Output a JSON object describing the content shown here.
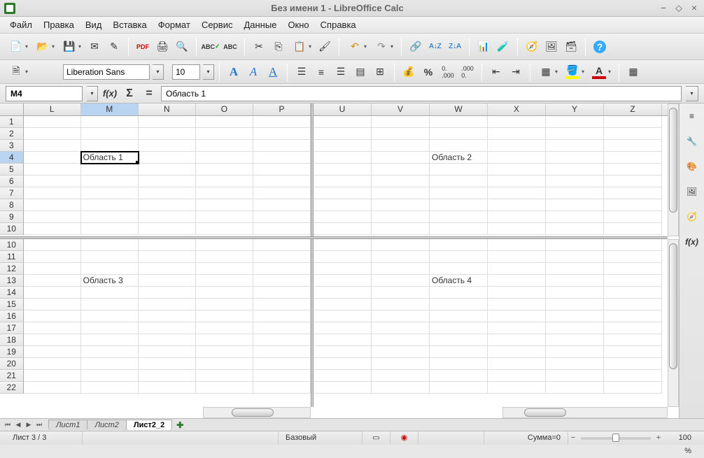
{
  "window": {
    "title": "Без имени 1 - LibreOffice Calc"
  },
  "menu": [
    "Файл",
    "Правка",
    "Вид",
    "Вставка",
    "Формат",
    "Сервис",
    "Данные",
    "Окно",
    "Справка"
  ],
  "font": {
    "name": "Liberation Sans",
    "size": "10"
  },
  "namebox": "M4",
  "formula": "Область 1",
  "cells": {
    "pane1": {
      "cols": [
        "L",
        "M",
        "N",
        "O",
        "P"
      ],
      "rows": [
        "1",
        "2",
        "3",
        "4",
        "5",
        "6",
        "7",
        "8",
        "9",
        "10"
      ],
      "data": {
        "M4": "Область 1"
      },
      "active": "M4"
    },
    "pane2": {
      "cols": [
        "U",
        "V",
        "W",
        "X",
        "Y",
        "Z"
      ],
      "rows": [
        "1",
        "2",
        "3",
        "4",
        "5",
        "6",
        "7",
        "8",
        "9",
        "10"
      ],
      "data": {
        "W4": "Область 2"
      }
    },
    "pane3": {
      "cols": [
        "L",
        "M",
        "N",
        "O",
        "P"
      ],
      "rows": [
        "10",
        "11",
        "12",
        "13",
        "14",
        "15",
        "16",
        "17",
        "18",
        "19",
        "20",
        "21",
        "22"
      ],
      "data": {
        "M13": "Область 3"
      }
    },
    "pane4": {
      "cols": [
        "U",
        "V",
        "W",
        "X",
        "Y",
        "Z"
      ],
      "rows": [
        "10",
        "11",
        "12",
        "13",
        "14",
        "15",
        "16",
        "17",
        "18",
        "19",
        "20",
        "21",
        "22"
      ],
      "data": {
        "W13": "Область 4"
      }
    }
  },
  "tabs": {
    "items": [
      "Лист1",
      "Лист2",
      "Лист2_2"
    ],
    "active": 2
  },
  "status": {
    "sheet": "Лист 3 / 3",
    "style": "Базовый",
    "sum": "Сумма=0",
    "zoom": "100 %"
  }
}
